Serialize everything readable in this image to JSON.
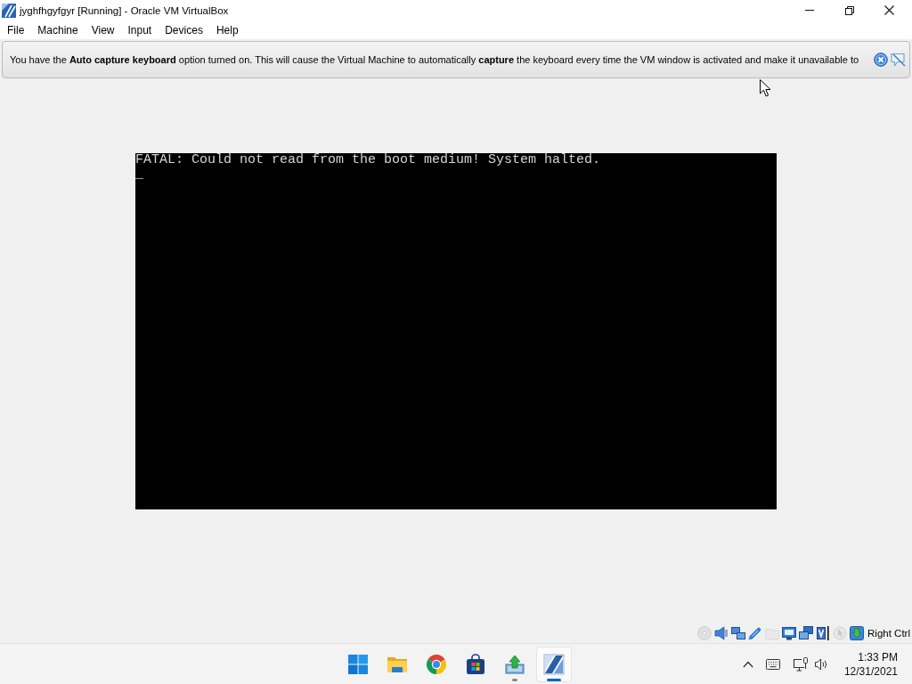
{
  "window": {
    "title": "jyghfhgyfgyr [Running] - Oracle VM VirtualBox"
  },
  "menu": [
    "File",
    "Machine",
    "View",
    "Input",
    "Devices",
    "Help"
  ],
  "notice": {
    "text": "You have the **Auto capture keyboard** option turned on. This will cause the Virtual Machine to automatically **capture** the keyboard every time the VM window is activated and make it unavailable to"
  },
  "vm_screen": {
    "lines": [
      "FATAL: Could not read from the boot medium! System halted.",
      "_"
    ]
  },
  "status_bar": {
    "indicators": [
      {
        "kind": "optical",
        "disabled": true
      },
      {
        "kind": "audio",
        "disabled": false
      },
      {
        "kind": "network",
        "disabled": false
      },
      {
        "kind": "usb",
        "disabled": false
      },
      {
        "kind": "shared-folders",
        "disabled": true
      },
      {
        "kind": "display",
        "disabled": false
      },
      {
        "kind": "capture",
        "disabled": false
      },
      {
        "kind": "recording",
        "disabled": false
      },
      {
        "kind": "mouse",
        "disabled": true
      },
      {
        "kind": "keyboard",
        "disabled": false
      }
    ],
    "host_key": "Right Ctrl"
  },
  "taskbar": {
    "apps": [
      {
        "kind": "start",
        "running": false,
        "selected": false
      },
      {
        "kind": "explorer",
        "running": false,
        "selected": false
      },
      {
        "kind": "browser",
        "running": false,
        "selected": false
      },
      {
        "kind": "store",
        "running": false,
        "selected": false
      },
      {
        "kind": "vbox-manager",
        "running": true,
        "selected": false
      },
      {
        "kind": "vm",
        "running": true,
        "selected": true
      }
    ],
    "tray": {
      "time": "1:33 PM",
      "date": "12/31/2021"
    }
  }
}
